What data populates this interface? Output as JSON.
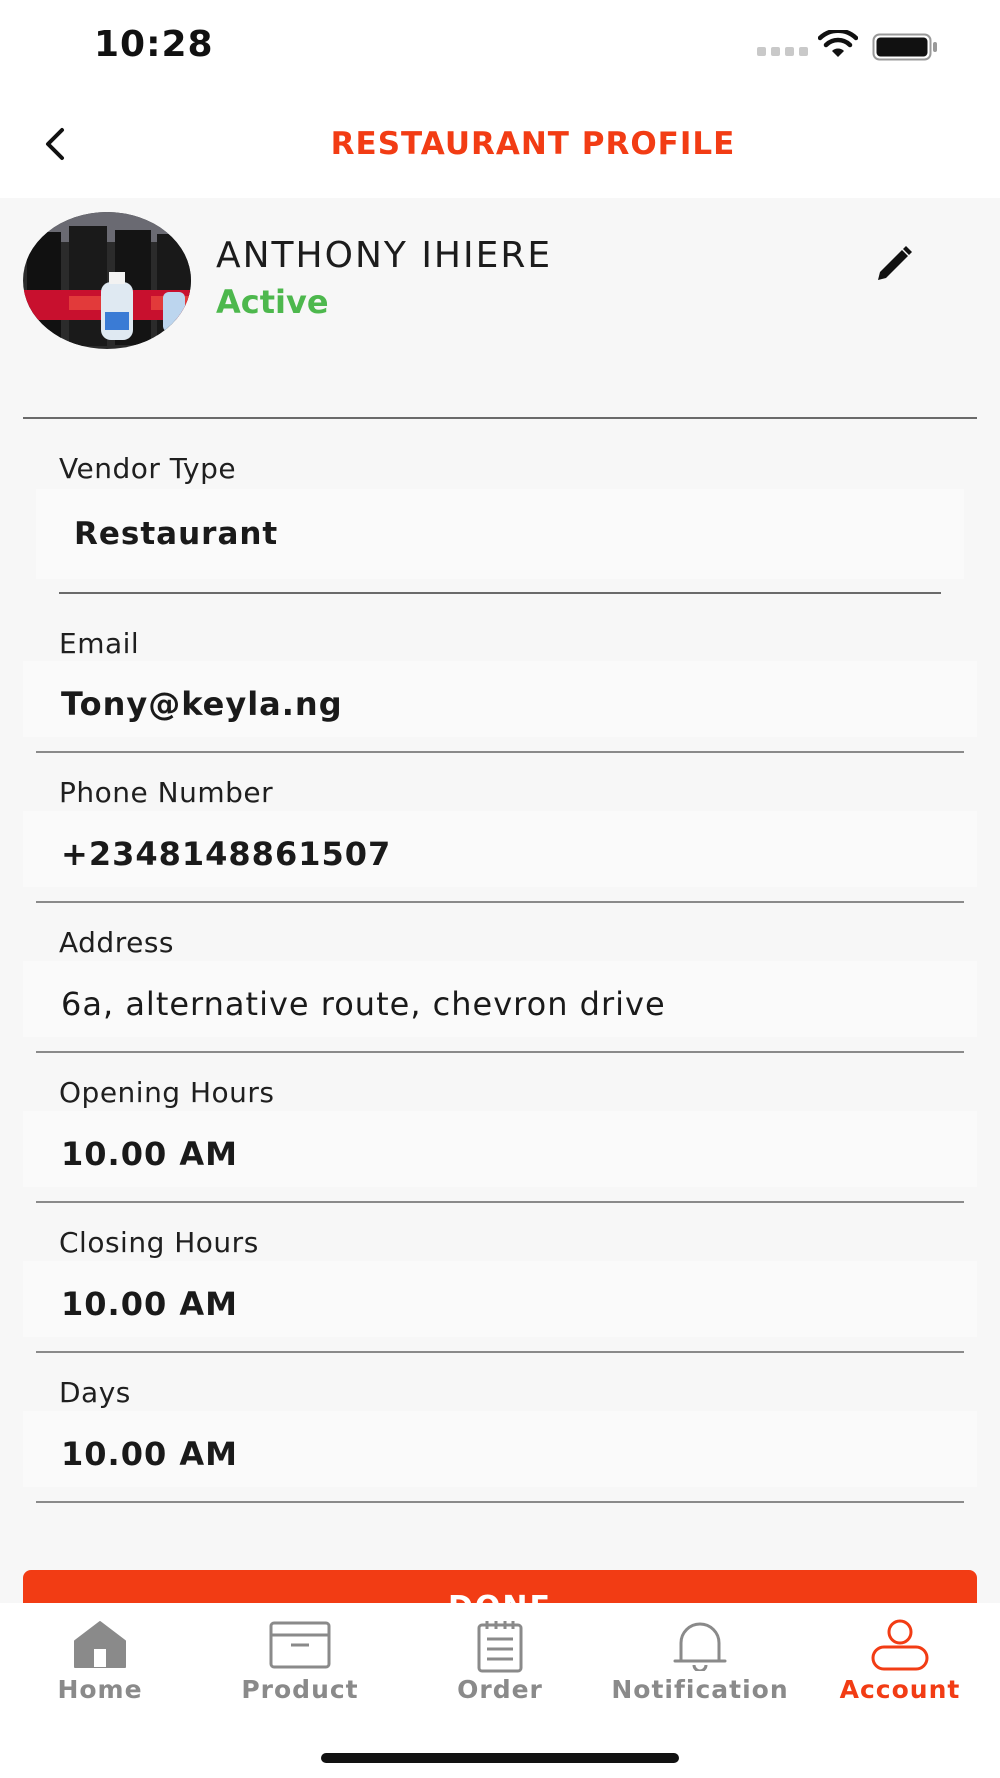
{
  "status_bar": {
    "time": "10:28"
  },
  "header": {
    "title": "RESTAURANT PROFILE"
  },
  "profile": {
    "name": "ANTHONY IHIERE",
    "status": "Active"
  },
  "fields": [
    {
      "label": "Vendor Type",
      "value": "Restaurant"
    },
    {
      "label": "Email",
      "value": "Tony@keyla.ng"
    },
    {
      "label": "Phone Number",
      "value": "+2348148861507"
    },
    {
      "label": "Address",
      "value": "6a, alternative route, chevron drive"
    },
    {
      "label": "Opening Hours",
      "value": "10.00 AM"
    },
    {
      "label": "Closing Hours",
      "value": "10.00 AM"
    },
    {
      "label": "Days",
      "value": "10.00 AM"
    }
  ],
  "done_button": {
    "label": "DONE"
  },
  "tabs": [
    {
      "label": "Home",
      "icon": "home-icon"
    },
    {
      "label": "Product",
      "icon": "product-icon"
    },
    {
      "label": "Order",
      "icon": "order-icon"
    },
    {
      "label": "Notification",
      "icon": "bell-icon"
    },
    {
      "label": "Account",
      "icon": "account-icon",
      "active": true
    }
  ],
  "colors": {
    "accent": "#f23c14",
    "status_active": "#4db84d",
    "inactive_tab": "#8a8a8a"
  }
}
